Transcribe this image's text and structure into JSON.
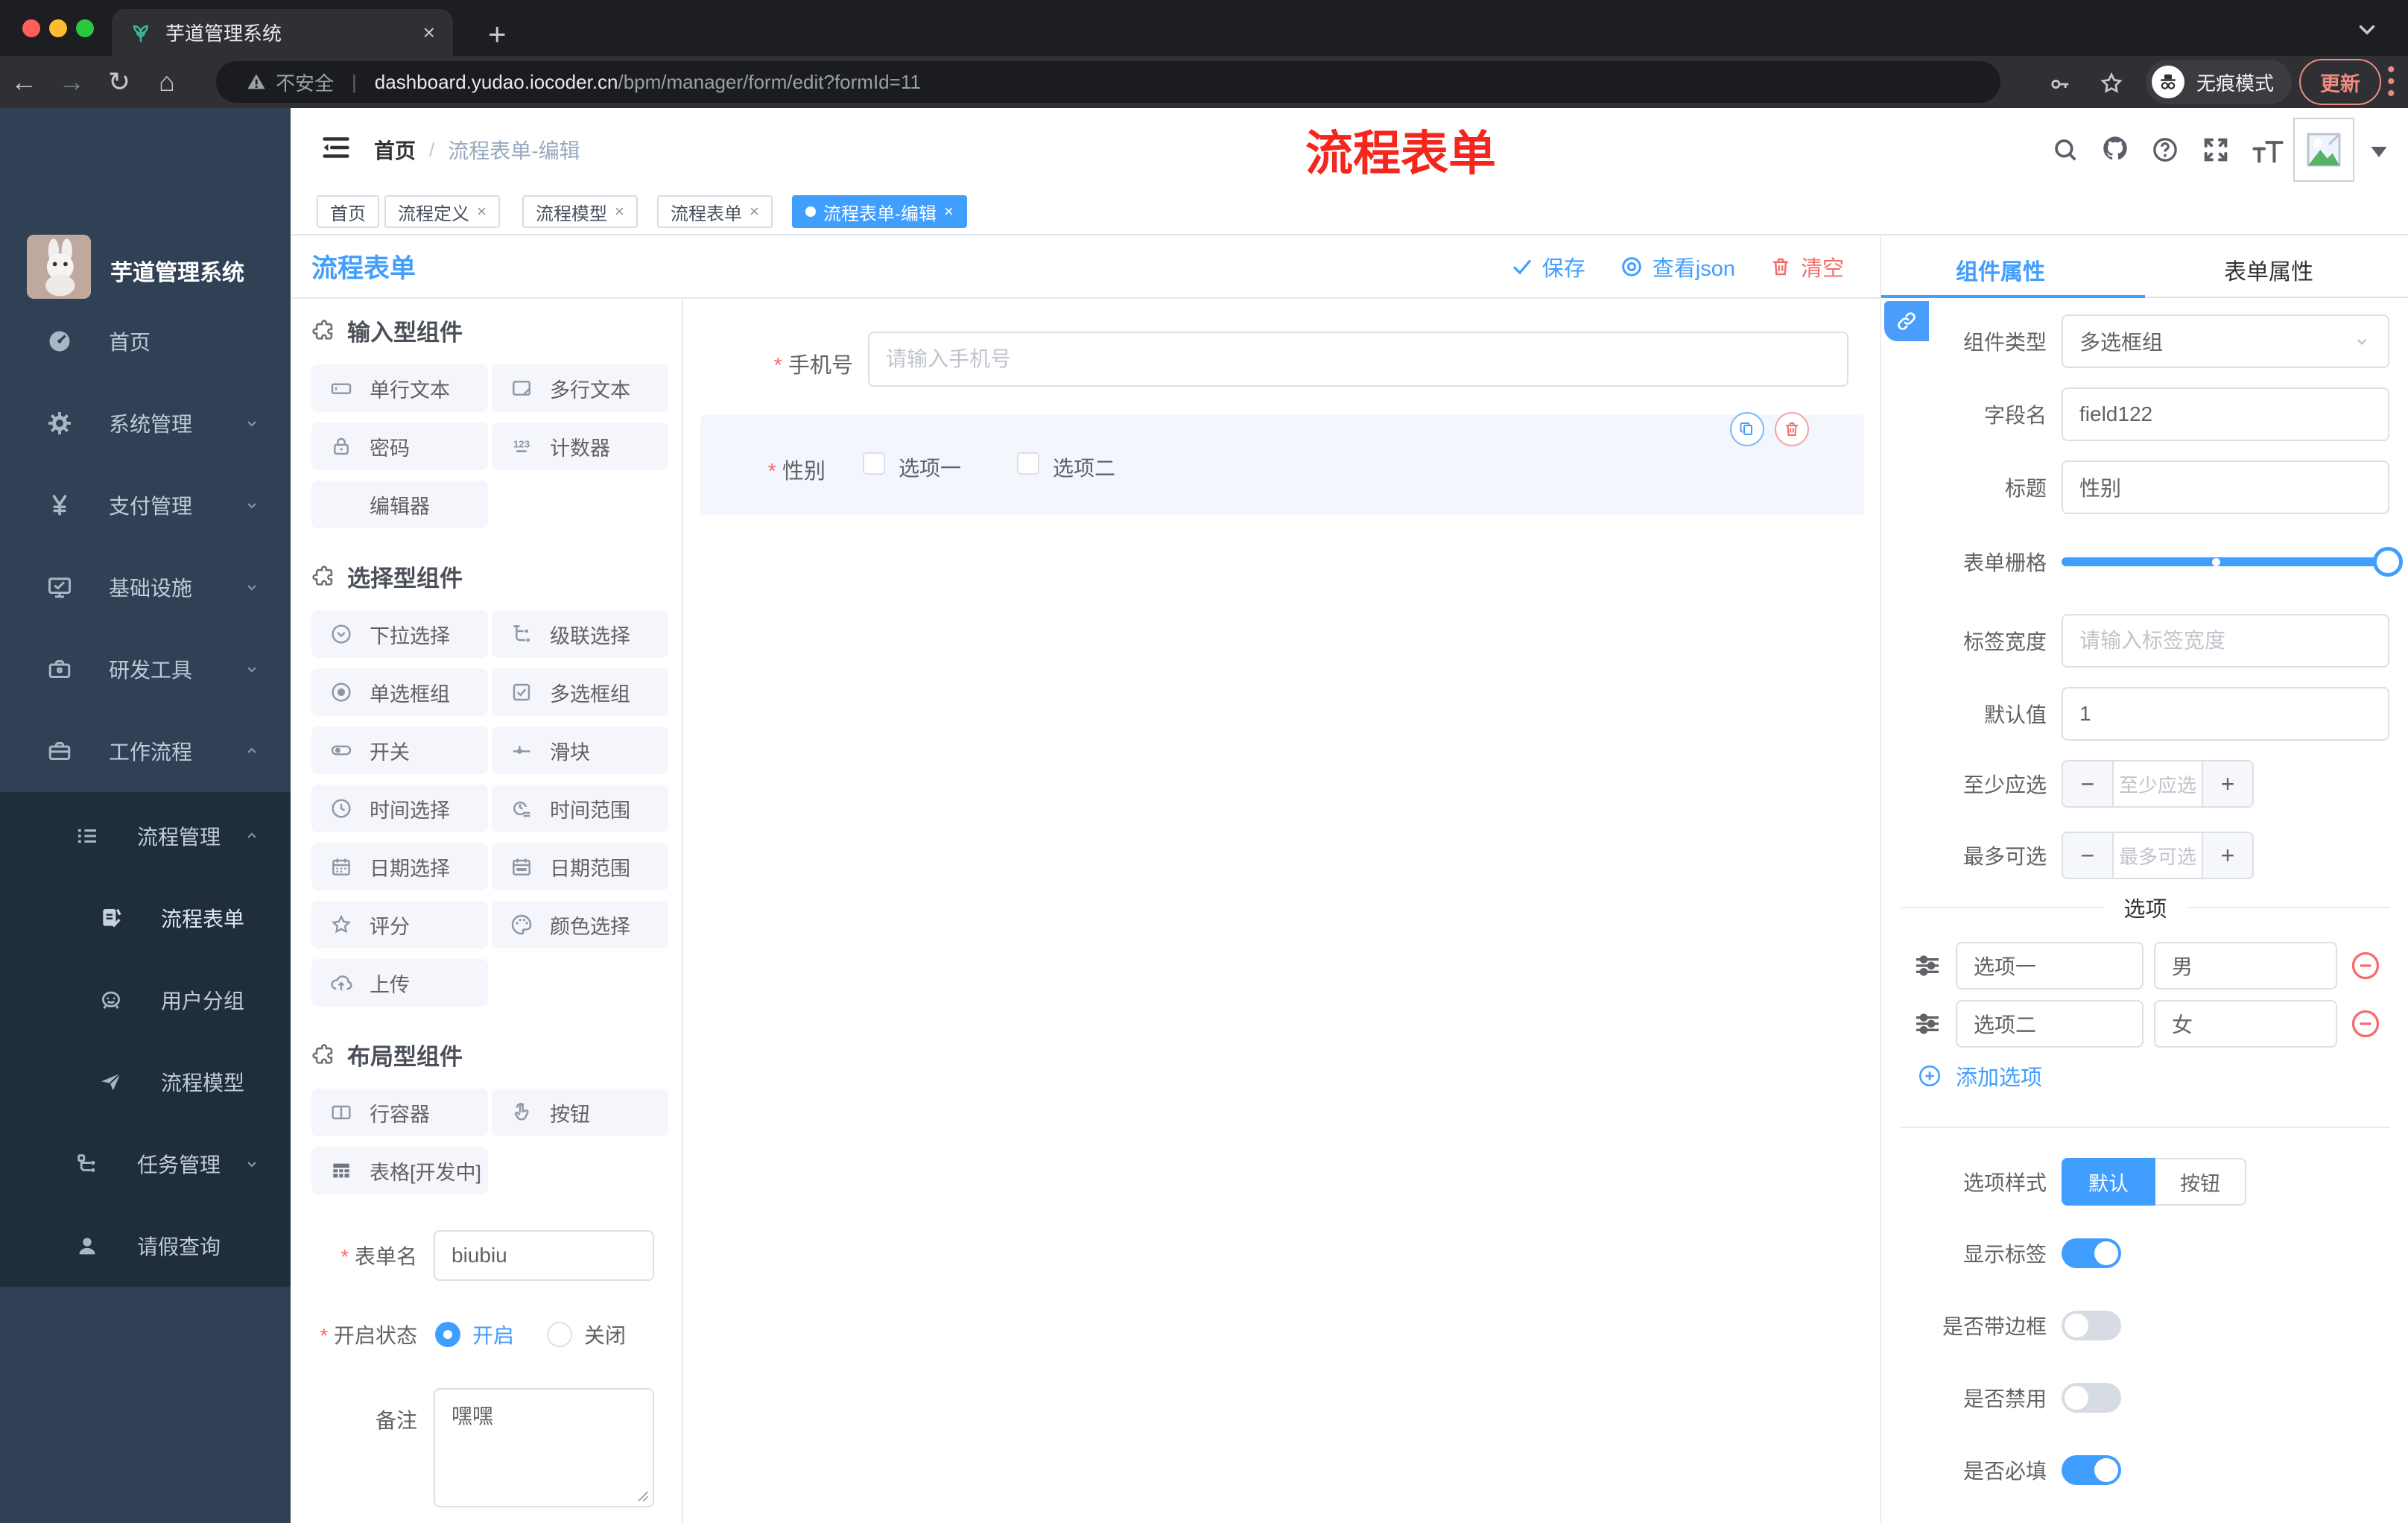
{
  "browser": {
    "tab_title": "芋道管理系统",
    "security_label": "不安全",
    "url_host": "dashboard.yudao.iocoder.cn",
    "url_path": "/bpm/manager/form/edit?formId=11",
    "incognito_label": "无痕模式",
    "update_label": "更新"
  },
  "sidebar": {
    "app_title": "芋道管理系统",
    "items": [
      {
        "label": "首页",
        "icon": "dashboard-icon"
      },
      {
        "label": "系统管理",
        "icon": "gear-icon"
      },
      {
        "label": "支付管理",
        "icon": "yen-icon"
      },
      {
        "label": "基础设施",
        "icon": "monitor-icon"
      },
      {
        "label": "研发工具",
        "icon": "toolbox-icon"
      },
      {
        "label": "工作流程",
        "icon": "briefcase-icon"
      }
    ],
    "submenu": [
      {
        "label": "流程管理",
        "icon": "list-icon"
      },
      {
        "label": "流程表单",
        "icon": "form-doc-icon"
      },
      {
        "label": "用户分组",
        "icon": "face-icon"
      },
      {
        "label": "流程模型",
        "icon": "send-icon"
      },
      {
        "label": "任务管理",
        "icon": "tree-icon"
      },
      {
        "label": "请假查询",
        "icon": "user-icon"
      }
    ]
  },
  "navbar": {
    "breadcrumb": [
      "首页",
      "流程表单-编辑"
    ],
    "breadcrumb_sep": "/",
    "overlay_title": "流程表单",
    "overlay_color": "#f5261d"
  },
  "tags": [
    {
      "label": "首页",
      "closable": false,
      "active": false
    },
    {
      "label": "流程定义",
      "closable": true,
      "active": false
    },
    {
      "label": "流程模型",
      "closable": true,
      "active": false
    },
    {
      "label": "流程表单",
      "closable": true,
      "active": false
    },
    {
      "label": "流程表单-编辑",
      "closable": true,
      "active": true
    }
  ],
  "designer": {
    "title": "流程表单",
    "save_label": "保存",
    "view_json_label": "查看json",
    "clear_label": "清空",
    "accent": "#409eff",
    "danger": "#f56c6c"
  },
  "components_panel": {
    "sections": [
      {
        "title": "输入型组件",
        "items": [
          {
            "label": "单行文本",
            "icon": "input-icon"
          },
          {
            "label": "多行文本",
            "icon": "textarea-icon"
          },
          {
            "label": "密码",
            "icon": "lock-icon"
          },
          {
            "label": "计数器",
            "icon": "number-icon"
          },
          {
            "label": "编辑器",
            "icon": ""
          }
        ]
      },
      {
        "title": "选择型组件",
        "items": [
          {
            "label": "下拉选择",
            "icon": "select-icon"
          },
          {
            "label": "级联选择",
            "icon": "cascader-icon"
          },
          {
            "label": "单选框组",
            "icon": "radio-icon"
          },
          {
            "label": "多选框组",
            "icon": "checkbox-icon"
          },
          {
            "label": "开关",
            "icon": "switch-icon"
          },
          {
            "label": "滑块",
            "icon": "slider-icon"
          },
          {
            "label": "时间选择",
            "icon": "time-icon"
          },
          {
            "label": "时间范围",
            "icon": "time-range-icon"
          },
          {
            "label": "日期选择",
            "icon": "date-icon"
          },
          {
            "label": "日期范围",
            "icon": "date-range-icon"
          },
          {
            "label": "评分",
            "icon": "star-icon"
          },
          {
            "label": "颜色选择",
            "icon": "palette-icon"
          },
          {
            "label": "上传",
            "icon": "upload-icon"
          }
        ]
      },
      {
        "title": "布局型组件",
        "items": [
          {
            "label": "行容器",
            "icon": "row-icon"
          },
          {
            "label": "按钮",
            "icon": "button-icon"
          },
          {
            "label": "表格[开发中]",
            "icon": "table-icon"
          }
        ]
      }
    ],
    "form": {
      "name_label": "表单名",
      "name_value": "biubiu",
      "status_label": "开启状态",
      "status_on": "开启",
      "status_off": "关闭",
      "status_selected": "开启",
      "remark_label": "备注",
      "remark_value": "嘿嘿"
    }
  },
  "canvas": {
    "phone_field": {
      "label": "手机号",
      "placeholder": "请输入手机号",
      "required": true
    },
    "gender_field": {
      "label": "性别",
      "required": true,
      "options": [
        "选项一",
        "选项二"
      ]
    }
  },
  "props_panel": {
    "tabs": [
      {
        "label": "组件属性",
        "active": true
      },
      {
        "label": "表单属性",
        "active": false
      }
    ],
    "component_type_label": "组件类型",
    "component_type_value": "多选框组",
    "field_name_label": "字段名",
    "field_name_value": "field122",
    "title_label": "标题",
    "title_value": "性别",
    "grid_label": "表单栅格",
    "grid_value_pct": 100,
    "grid_mark_pct": 46,
    "label_width_label": "标签宽度",
    "label_width_placeholder": "请输入标签宽度",
    "default_label": "默认值",
    "default_value": "1",
    "min_label": "至少应选",
    "min_placeholder": "至少应选",
    "max_label": "最多可选",
    "max_placeholder": "最多可选",
    "options_divider": "选项",
    "options": [
      {
        "label": "选项一",
        "value": "男"
      },
      {
        "label": "选项二",
        "value": "女"
      }
    ],
    "add_option_label": "添加选项",
    "option_style_label": "选项样式",
    "option_style_default": "默认",
    "option_style_button": "按钮",
    "toggles": [
      {
        "label": "显示标签",
        "on": true
      },
      {
        "label": "是否带边框",
        "on": false
      },
      {
        "label": "是否禁用",
        "on": false
      },
      {
        "label": "是否必填",
        "on": true
      }
    ]
  }
}
